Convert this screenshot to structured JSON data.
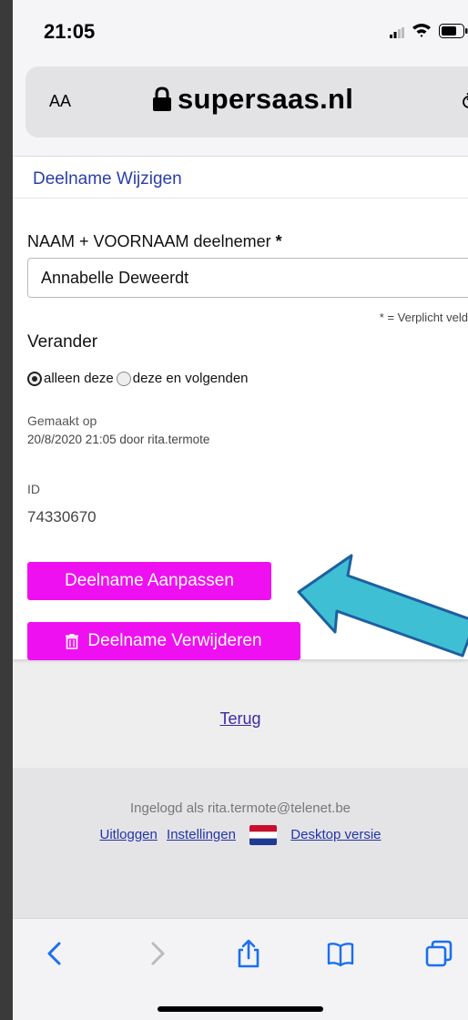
{
  "status_bar": {
    "time": "21:05"
  },
  "address_bar": {
    "text_size_label": "AA",
    "domain": "supersaas.nl"
  },
  "page": {
    "header_link": "Deelname Wijzigen",
    "name_label": "NAAM + VOORNAAM deelnemer",
    "required_marker": "*",
    "name_value": "Annabelle Deweerdt",
    "required_note": "* = Verplicht veld",
    "change_label": "Verander",
    "radio_options": [
      "alleen deze",
      "deze en volgenden"
    ],
    "radio_selected": "alleen deze",
    "created_label": "Gemaakt op",
    "created_value": "20/8/2020 21:05 door rita.termote",
    "id_label": "ID",
    "id_value": "74330670",
    "update_button": "Deelname Aanpassen",
    "delete_button": "Deelname Verwijderen",
    "back_link": "Terug"
  },
  "footer": {
    "logged_in": "Ingelogd als rita.termote@telenet.be",
    "logout": "Uitloggen",
    "settings": "Instellingen",
    "desktop": "Desktop versie"
  },
  "colors": {
    "accent_button": "#ee10f0",
    "link": "#2b3ea8",
    "annotation_arrow": "#3fbfd4"
  },
  "icons": [
    "signal-icon",
    "wifi-icon",
    "battery-icon",
    "lock-icon",
    "reload-icon",
    "trash-icon",
    "dutch-flag-icon",
    "back-icon",
    "forward-icon",
    "share-icon",
    "bookmarks-icon",
    "tabs-icon"
  ]
}
